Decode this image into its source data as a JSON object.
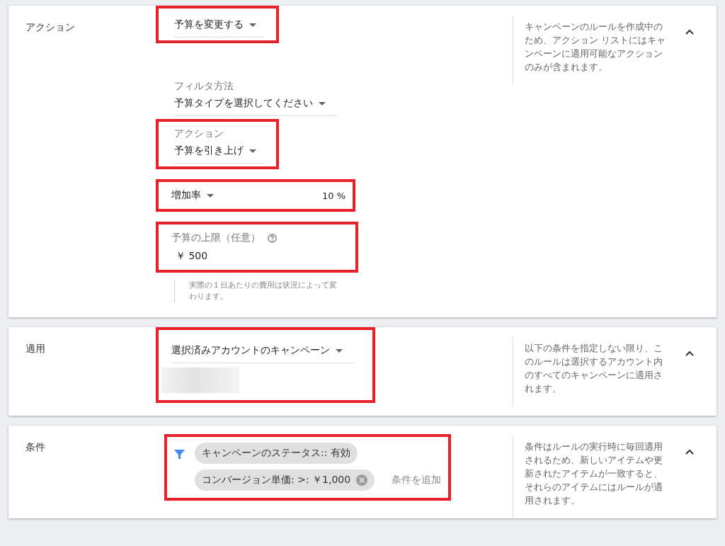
{
  "sections": [
    {
      "label": "アクション",
      "expanded": true,
      "help": "キャンペーンのルールを作成中のため、アクション リストにはキャンペーンに適用可能なアクションのみが含まれます。",
      "items": [
        {
          "kind": "dropdown",
          "value": "予算を変更する",
          "highlighted": true
        },
        {
          "kind": "dropdown",
          "caption": "フィルタ方法",
          "value": "予算タイプを選択してください",
          "highlighted": false
        },
        {
          "kind": "dropdown",
          "caption": "アクション",
          "value": "予算を引き上げ",
          "highlighted": true
        },
        {
          "kind": "rate",
          "value": "増加率",
          "amount": "10 %",
          "highlighted": true
        },
        {
          "kind": "amount",
          "caption": "予算の上限（任意）",
          "currency": "￥",
          "amount": "500",
          "highlighted": true
        },
        {
          "kind": "note",
          "text": "実際の１日あたりの費用は状況によって変わります。"
        }
      ]
    },
    {
      "label": "適用",
      "expanded": true,
      "help": "以下の条件を指定しない限り、このルールは選択するアカウント内のすべてのキャンペーンに適用されます。",
      "items": [
        {
          "kind": "scope",
          "value": "選択済みアカウントのキャンペーン",
          "highlighted": true
        }
      ]
    },
    {
      "label": "条件",
      "expanded": true,
      "help": "条件はルールの実行時に毎回適用されるため、新しいアイテムや更新されたアイテムが一致すると、それらのアイテムにはルールが適用されます。",
      "items": [
        {
          "kind": "conditions",
          "highlighted": true,
          "chips": [
            {
              "text": "キャンペーンのステータス:: 有効",
              "removable": false
            },
            {
              "text": "コンバージョン単価: >: ￥1,000",
              "removable": true
            }
          ],
          "add_link": "条件を追加"
        }
      ]
    }
  ]
}
